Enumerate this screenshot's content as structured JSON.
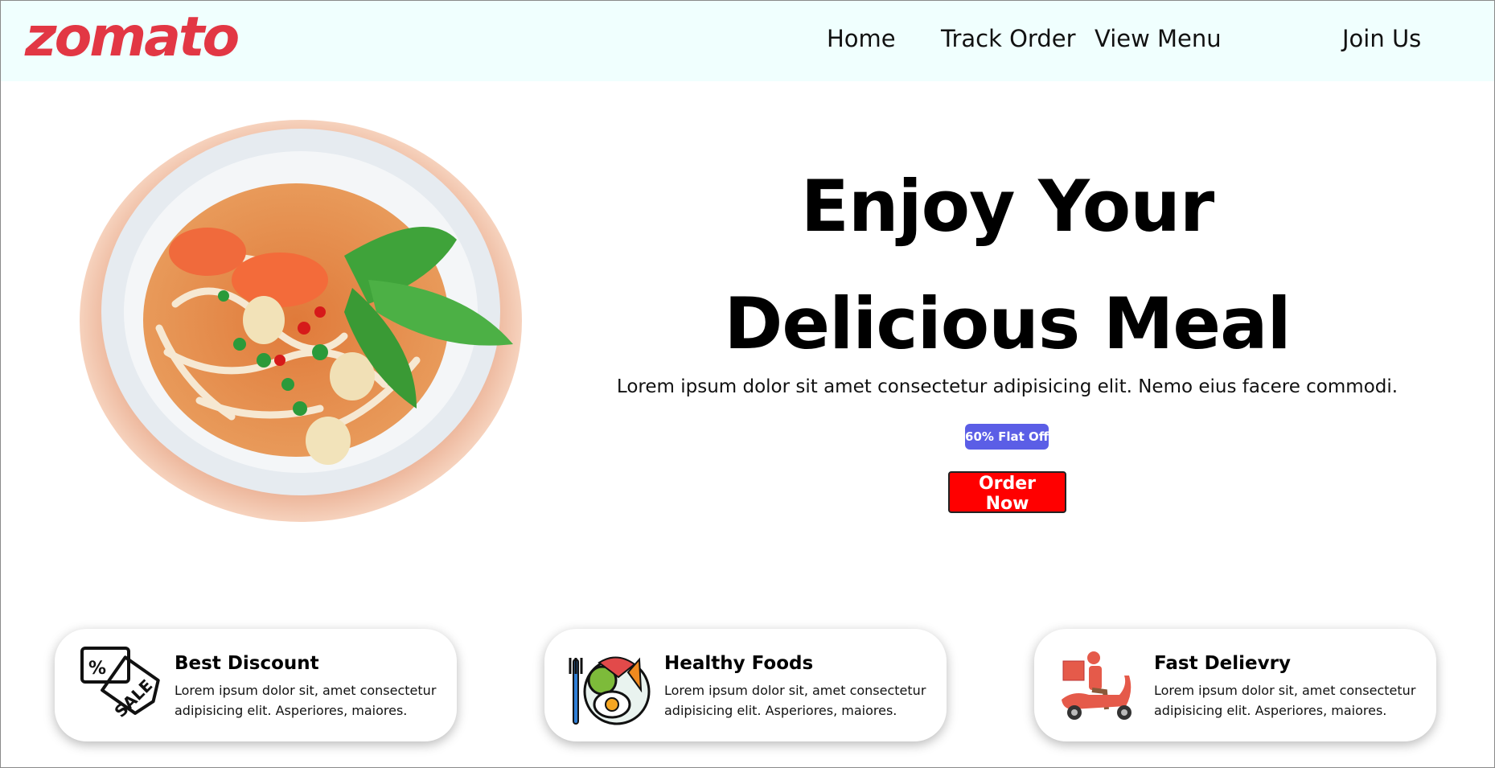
{
  "brand": {
    "logo": "zomato",
    "logo_color": "#e23744"
  },
  "nav": {
    "items": [
      "Home",
      "Track Order",
      "View Menu",
      "Join Us"
    ]
  },
  "hero": {
    "title_line1": "Enjoy Your",
    "title_line2": "Delicious Meal",
    "description": "Lorem ipsum dolor sit amet consectetur adipisicing elit. Nemo eius facere commodi.",
    "badge": "60% Flat Off",
    "cta": "Order Now",
    "image": "noodle-soup-bowl"
  },
  "features": [
    {
      "icon": "sale-tag-icon",
      "title": "Best Discount",
      "text": "Lorem ipsum dolor sit, amet consectetur adipisicing elit. Asperiores, maiores."
    },
    {
      "icon": "healthy-food-plate-icon",
      "title": "Healthy Foods",
      "text": "Lorem ipsum dolor sit, amet consectetur adipisicing elit. Asperiores, maiores."
    },
    {
      "icon": "delivery-scooter-icon",
      "title": "Fast Delievry",
      "text": "Lorem ipsum dolor sit, amet consectetur adipisicing elit. Asperiores, maiores."
    }
  ],
  "colors": {
    "header_bg": "#f0fffe",
    "badge_bg": "#5b5ee6",
    "cta_bg": "#ff0000"
  }
}
